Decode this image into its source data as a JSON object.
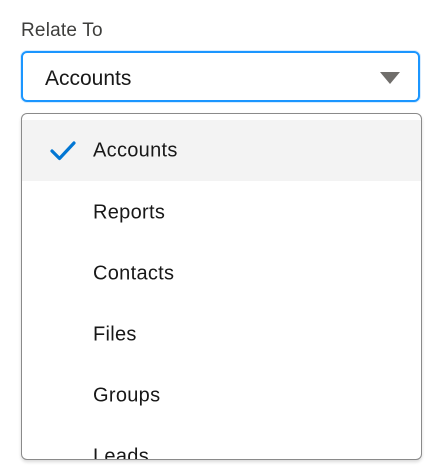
{
  "field": {
    "label": "Relate To",
    "selected_value": "Accounts"
  },
  "dropdown": {
    "options": [
      {
        "label": "Accounts",
        "selected": true,
        "icon": "check-icon"
      },
      {
        "label": "Reports",
        "selected": false
      },
      {
        "label": "Contacts",
        "selected": false
      },
      {
        "label": "Files",
        "selected": false
      },
      {
        "label": "Groups",
        "selected": false
      },
      {
        "label": "Leads",
        "selected": false
      }
    ]
  },
  "colors": {
    "focus_border": "#1b96ff",
    "check": "#0176d3",
    "selected_bg": "#f3f3f3"
  }
}
